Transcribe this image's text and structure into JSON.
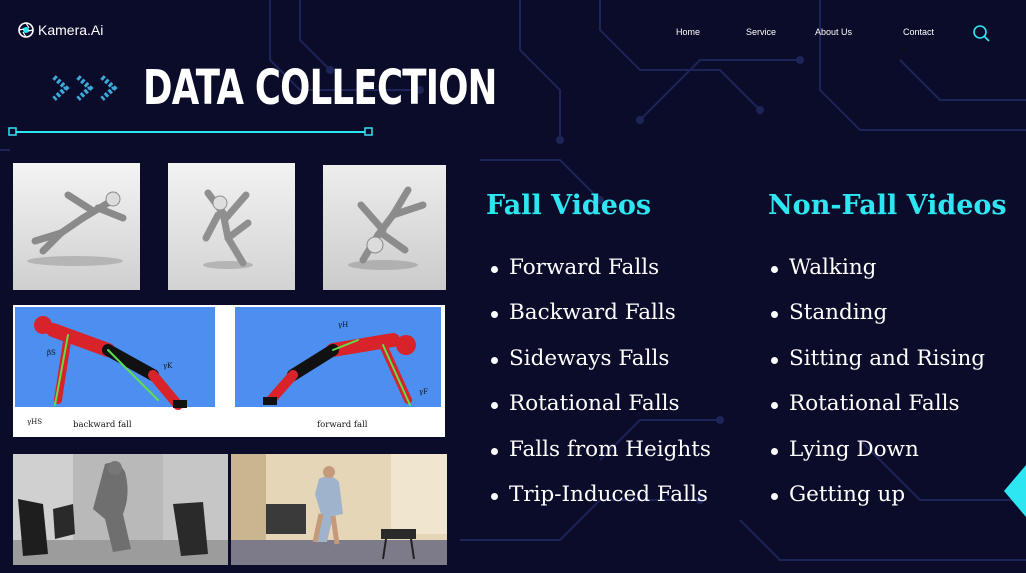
{
  "header": {
    "brand": "Kamera.Ai",
    "nav": [
      "Home",
      "Service",
      "About Us",
      "Contact"
    ]
  },
  "page_title": "DATA COLLECTION",
  "figures": {
    "backward_label": "backward fall",
    "forward_label": "forward fall",
    "symbols": {
      "beta_s": "βS",
      "gamma_k": "γK",
      "gamma_hs": "γHS",
      "gamma_h": "γH",
      "gamma_f": "γF"
    }
  },
  "fall_videos": {
    "title": "Fall Videos",
    "items": [
      "Forward Falls",
      "Backward Falls",
      "Sideways Falls",
      "Rotational Falls",
      "Falls from Heights",
      "Trip-Induced Falls"
    ]
  },
  "non_fall_videos": {
    "title": "Non-Fall Videos",
    "items": [
      "Walking",
      "Standing",
      "Sitting and Rising",
      "Rotational Falls",
      "Lying Down",
      "Getting up"
    ]
  },
  "colors": {
    "background": "#0b0b2a",
    "accent": "#2ee6f2",
    "circuit": "#1d2458",
    "diagram_blue": "#4d8ff0"
  },
  "icons": {
    "brand": "camera-aperture-icon",
    "search": "search-icon",
    "chevrons": "triple-chevron-icon",
    "next": "next-arrow-icon"
  }
}
